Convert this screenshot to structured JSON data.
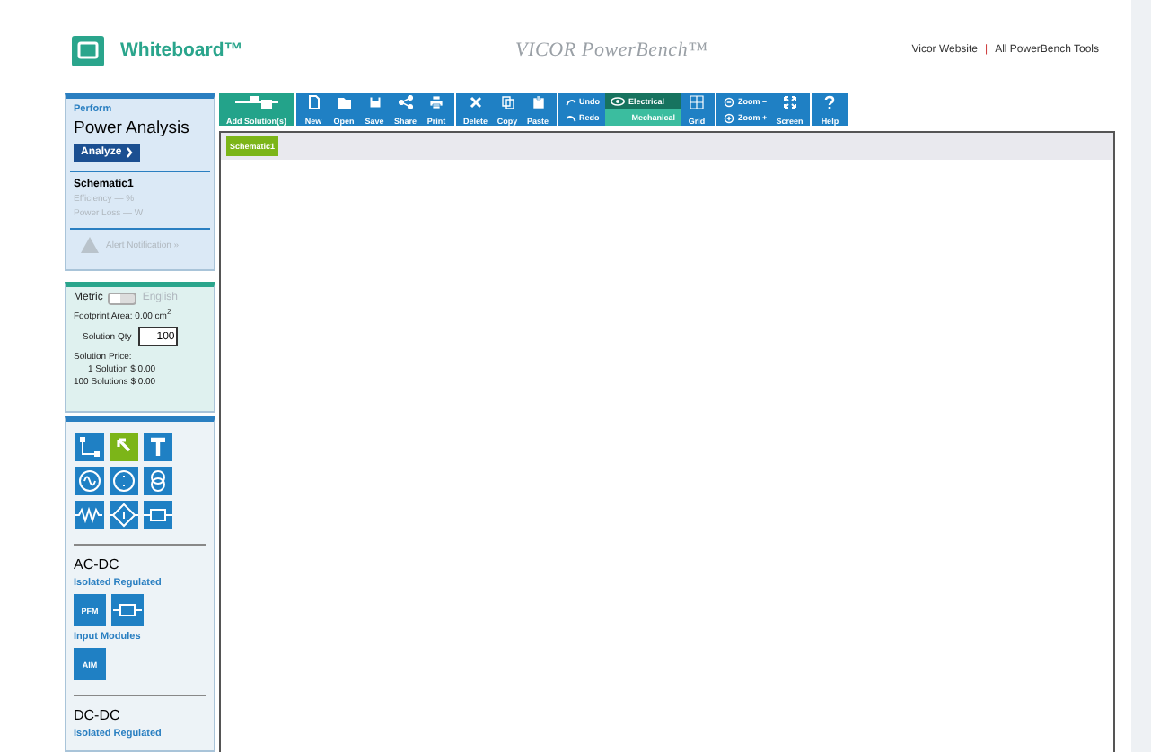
{
  "header": {
    "title": "Whiteboard™",
    "brand": "VICOR PowerBench™",
    "links": [
      "Vicor Website",
      "|",
      "All PowerBench Tools"
    ]
  },
  "analysis": {
    "eyebrow": "Perform",
    "title": "Power Analysis",
    "button": "Analyze",
    "schematic": "Schematic1",
    "metrics": [
      "Efficiency — %",
      "Power Loss — W"
    ],
    "alert": "Alert Notification »"
  },
  "solution": {
    "units": [
      {
        "label": "Metric",
        "selected": true
      },
      {
        "label": "English",
        "selected": false
      }
    ],
    "footprint": "Footprint Area: 0.00 cm$^{2}$",
    "qty_label": "Solution Qty",
    "qty": "100",
    "price_label": "Solution Price:",
    "prices": [
      "1 Solution $ 0.00",
      "100 Solutions $ 0.00"
    ]
  },
  "tools": [
    {
      "selected": false
    },
    {
      "selected": true
    },
    {
      "selected": false
    },
    {
      "selected": false
    },
    {
      "selected": false
    },
    {
      "selected": false
    },
    {
      "selected": false
    },
    {
      "selected": false
    },
    {
      "selected": false
    }
  ],
  "sections": [
    {
      "title": "AC-DC",
      "groups": [
        {
          "label": "Isolated Regulated",
          "modules": [
            {
              "kind": "text",
              "label": "PFM"
            },
            {
              "kind": "icon"
            }
          ]
        },
        {
          "label": "Input Modules",
          "modules": [
            {
              "kind": "text",
              "label": "AIM"
            }
          ]
        }
      ]
    },
    {
      "title": "DC-DC",
      "groups": [
        {
          "label": "Isolated Regulated"
        }
      ]
    }
  ],
  "toolbar": [
    {
      "kind": "add",
      "items": [
        {
          "label": "Add Solution(s)"
        }
      ]
    },
    {
      "kind": "plain",
      "items": [
        {
          "label": "New"
        },
        {
          "label": "Open"
        },
        {
          "label": "Save"
        },
        {
          "label": "Share"
        },
        {
          "label": "Print"
        }
      ]
    },
    {
      "kind": "plain",
      "items": [
        {
          "label": "Delete"
        },
        {
          "label": "Copy"
        },
        {
          "label": "Paste"
        }
      ]
    },
    {
      "kind": "edit",
      "stack": [
        {
          "label": "Undo"
        },
        {
          "label": "Redo"
        }
      ],
      "views": [
        {
          "label": "Electrical",
          "selected": true
        },
        {
          "label": "Mechanical",
          "selected": false
        }
      ],
      "items": [
        {
          "label": "Grid"
        }
      ]
    },
    {
      "kind": "zoom",
      "stack": [
        {
          "label": "Zoom –"
        },
        {
          "label": "Zoom +"
        }
      ],
      "items": [
        {
          "label": "Screen"
        }
      ]
    },
    {
      "kind": "plain",
      "items": [
        {
          "label": "Help"
        }
      ]
    }
  ],
  "canvas": {
    "tabs": [
      {
        "label": "Schematic1",
        "selected": true
      }
    ]
  }
}
